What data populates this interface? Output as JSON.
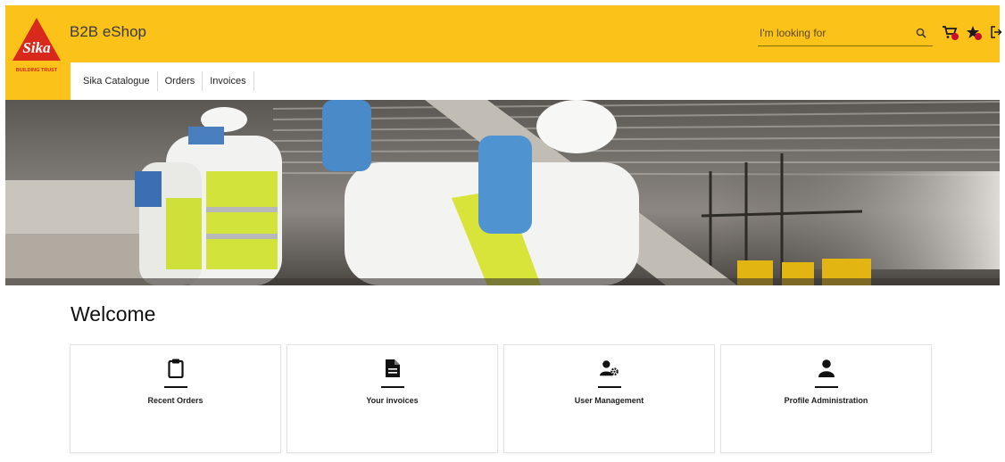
{
  "brand": {
    "logo_text": "Sika",
    "logo_tagline": "BUILDING TRUST",
    "title": "B2B eShop",
    "colors": {
      "header": "#fbc21a",
      "logo_red": "#d9281c",
      "badge": "#c8102e"
    }
  },
  "search": {
    "placeholder": "I'm looking for",
    "value": "",
    "icon": "search-icon"
  },
  "header_icons": [
    {
      "name": "cart-icon"
    },
    {
      "name": "favorites-star-icon"
    },
    {
      "name": "logout-icon"
    }
  ],
  "nav": {
    "items": [
      {
        "label": "Sika Catalogue"
      },
      {
        "label": "Orders"
      },
      {
        "label": "Invoices"
      }
    ]
  },
  "main": {
    "welcome": "Welcome",
    "tiles": [
      {
        "label": "Recent Orders",
        "icon": "clipboard-icon"
      },
      {
        "label": "Your invoices",
        "icon": "document-icon"
      },
      {
        "label": "User Management",
        "icon": "user-gear-icon"
      },
      {
        "label": "Profile Administration",
        "icon": "user-icon"
      }
    ]
  }
}
